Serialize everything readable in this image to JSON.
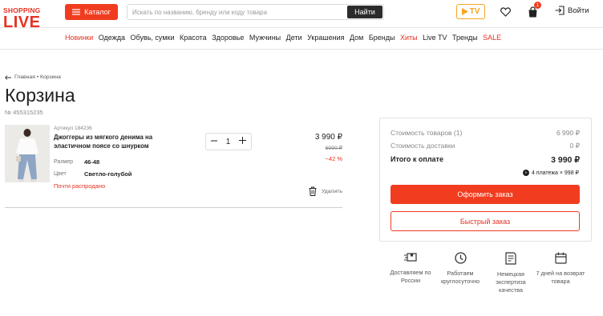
{
  "logo": {
    "line1": "SHOPPING",
    "line2": "LIVE"
  },
  "header": {
    "catalog_label": "Каталог",
    "search_placeholder": "Искать по названию, бренду или коду товара",
    "search_button": "Найти",
    "tv_label": "TV",
    "cart_count": "1",
    "login_label": "Войти"
  },
  "nav": {
    "items": [
      {
        "label": "Новинки",
        "accent": true
      },
      {
        "label": "Одежда",
        "accent": false
      },
      {
        "label": "Обувь, сумки",
        "accent": false
      },
      {
        "label": "Красота",
        "accent": false
      },
      {
        "label": "Здоровье",
        "accent": false
      },
      {
        "label": "Мужчины",
        "accent": false
      },
      {
        "label": "Дети",
        "accent": false
      },
      {
        "label": "Украшения",
        "accent": false
      },
      {
        "label": "Дом",
        "accent": false
      },
      {
        "label": "Бренды",
        "accent": false
      },
      {
        "label": "Хиты",
        "accent": true
      },
      {
        "label": "Live TV",
        "accent": false
      },
      {
        "label": "Тренды",
        "accent": false
      },
      {
        "label": "SALE",
        "accent": true
      }
    ]
  },
  "breadcrumb": {
    "text": "Главная • Корзина"
  },
  "page": {
    "title": "Корзина",
    "order_number": "№ 455315235"
  },
  "item": {
    "article": "Артикул 184236",
    "name": "Джоггеры из мягкого денима на эластичном поясе со шнурком",
    "size_label": "Размер",
    "size_value": "46-48",
    "color_label": "Цвет",
    "color_value": "Светло-голубой",
    "availability": "Почти распродано",
    "quantity": "1",
    "price": "3 990 ₽",
    "old_price": "6990 ₽",
    "discount": "−42 %",
    "delete_label": "Удалить"
  },
  "summary": {
    "goods_label": "Стоимость товаров (1)",
    "goods_value": "6 990 ₽",
    "delivery_label": "Стоимость доставки",
    "delivery_value": "0 ₽",
    "total_label": "Итого к оплате",
    "total_value": "3 990 ₽",
    "installments": "4 платежа × 998 ₽",
    "checkout_button": "Оформить заказ",
    "quick_button": "Быстрый заказ"
  },
  "features": [
    {
      "icon": "delivery-icon",
      "text": "Доставляем по России"
    },
    {
      "icon": "clock-icon",
      "text": "Работаем круглосуточно"
    },
    {
      "icon": "checklist-icon",
      "text": "Немецкая экспертиза качества"
    },
    {
      "icon": "calendar-icon",
      "text": "7 дней на возврат товара"
    }
  ],
  "colors": {
    "accent": "#f13c20",
    "tv": "#f5a623"
  }
}
